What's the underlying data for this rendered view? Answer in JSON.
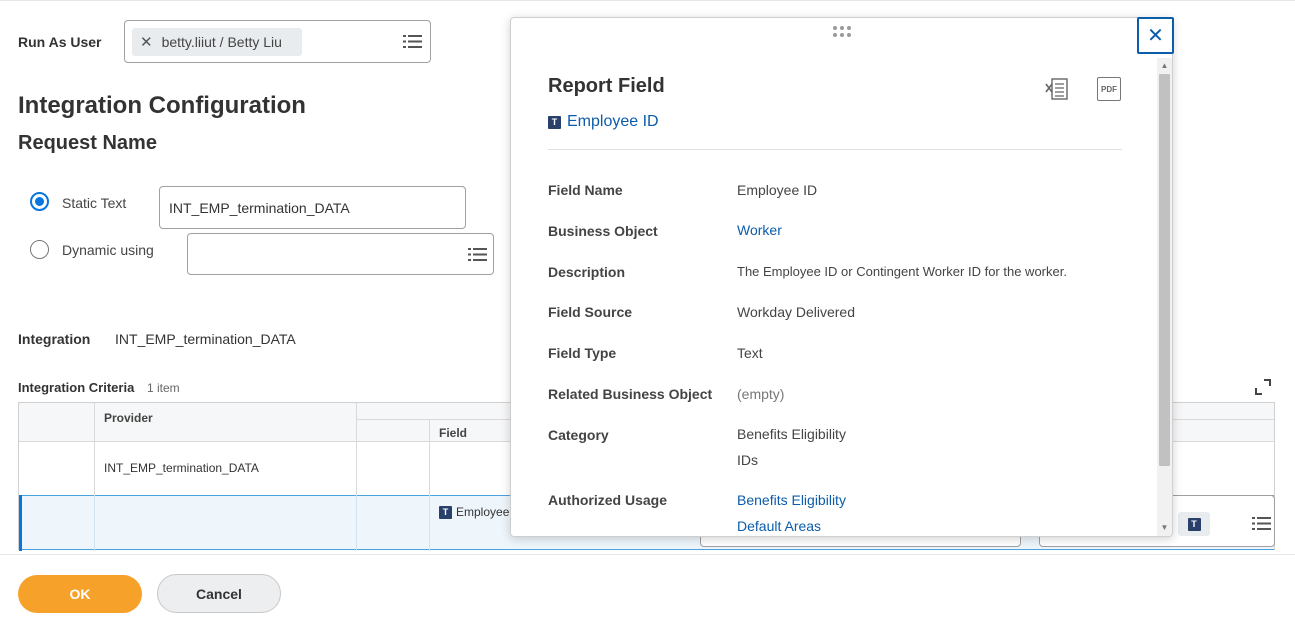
{
  "run_as": {
    "label": "Run As User",
    "user_token": "betty.liiut / Betty Liu"
  },
  "page": {
    "title": "Integration Configuration",
    "section": "Request Name"
  },
  "request_name": {
    "static_label": "Static Text",
    "static_value": "INT_EMP_termination_DATA",
    "static_selected": true,
    "dynamic_label": "Dynamic using",
    "dynamic_value": ""
  },
  "integration": {
    "label": "Integration",
    "value": "INT_EMP_termination_DATA"
  },
  "criteria": {
    "label": "Integration Criteria",
    "count": "1 item",
    "columns": {
      "provider": "Provider",
      "field": "Field"
    },
    "rows": [
      {
        "provider": "INT_EMP_termination_DATA"
      },
      {
        "field_prefix": "T",
        "field": "Employee"
      }
    ]
  },
  "footer": {
    "ok_label": "OK",
    "cancel_label": "Cancel"
  },
  "popup": {
    "title": "Report Field",
    "subtitle_icon": "T",
    "subtitle": "Employee ID",
    "close_glyph": "✕",
    "export_excel_icon": "excel-export-icon",
    "export_pdf_icon": "pdf-export-icon",
    "pdf_text": "PDF",
    "fields": [
      {
        "label": "Field Name",
        "value": "Employee ID"
      },
      {
        "label": "Business Object",
        "link": "Worker"
      },
      {
        "label": "Description",
        "value": "The Employee ID or Contingent Worker ID for the worker."
      },
      {
        "label": "Field Source",
        "value": "Workday Delivered"
      },
      {
        "label": "Field Type",
        "value": "Text"
      },
      {
        "label": "Related Business Object",
        "value": "(empty)"
      },
      {
        "label": "Category",
        "values": [
          "Benefits Eligibility",
          "IDs"
        ]
      },
      {
        "label": "Authorized Usage",
        "links": [
          "Benefits Eligibility",
          "Default Areas"
        ]
      }
    ]
  },
  "colors": {
    "primary_button": "#f6a12a",
    "link": "#0b5cab",
    "radio_selected": "#0875e1",
    "type_badge": "#29406b"
  }
}
